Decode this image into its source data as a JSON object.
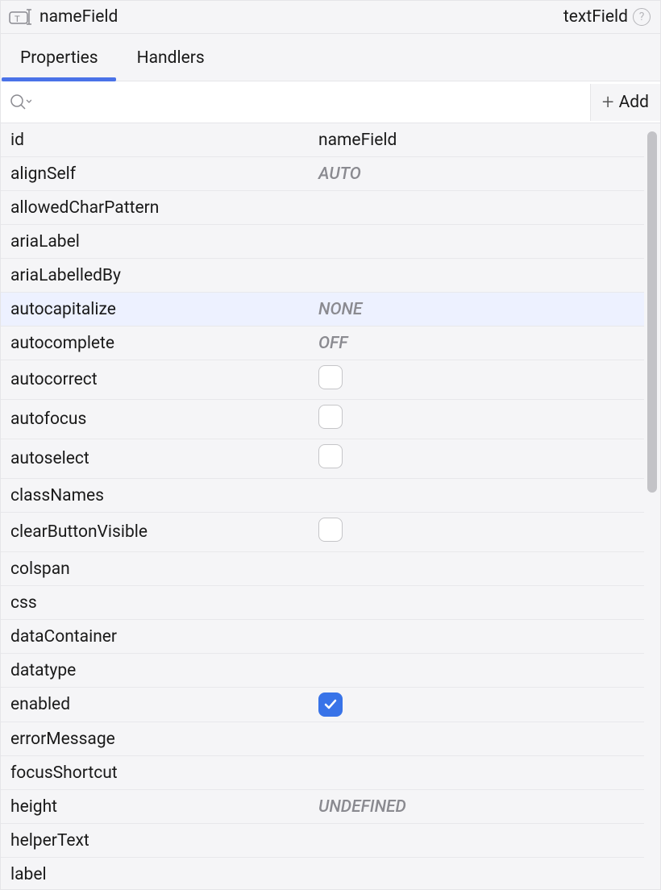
{
  "header": {
    "componentName": "nameField",
    "componentType": "textField"
  },
  "tabs": [
    {
      "label": "Properties",
      "active": true
    },
    {
      "label": "Handlers",
      "active": false
    }
  ],
  "toolbar": {
    "addLabel": "Add",
    "searchPlaceholder": ""
  },
  "properties": [
    {
      "name": "id",
      "value": "nameField",
      "type": "text"
    },
    {
      "name": "alignSelf",
      "value": "AUTO",
      "type": "placeholder"
    },
    {
      "name": "allowedCharPattern",
      "value": "",
      "type": "text"
    },
    {
      "name": "ariaLabel",
      "value": "",
      "type": "text"
    },
    {
      "name": "ariaLabelledBy",
      "value": "",
      "type": "text"
    },
    {
      "name": "autocapitalize",
      "value": "NONE",
      "type": "placeholder",
      "highlighted": true
    },
    {
      "name": "autocomplete",
      "value": "OFF",
      "type": "placeholder"
    },
    {
      "name": "autocorrect",
      "value": "",
      "type": "checkbox",
      "checked": false
    },
    {
      "name": "autofocus",
      "value": "",
      "type": "checkbox",
      "checked": false
    },
    {
      "name": "autoselect",
      "value": "",
      "type": "checkbox",
      "checked": false
    },
    {
      "name": "classNames",
      "value": "",
      "type": "text"
    },
    {
      "name": "clearButtonVisible",
      "value": "",
      "type": "checkbox",
      "checked": false
    },
    {
      "name": "colspan",
      "value": "",
      "type": "text"
    },
    {
      "name": "css",
      "value": "",
      "type": "text"
    },
    {
      "name": "dataContainer",
      "value": "",
      "type": "text"
    },
    {
      "name": "datatype",
      "value": "",
      "type": "text"
    },
    {
      "name": "enabled",
      "value": "",
      "type": "checkbox",
      "checked": true
    },
    {
      "name": "errorMessage",
      "value": "",
      "type": "text"
    },
    {
      "name": "focusShortcut",
      "value": "",
      "type": "text"
    },
    {
      "name": "height",
      "value": "UNDEFINED",
      "type": "placeholder"
    },
    {
      "name": "helperText",
      "value": "",
      "type": "text"
    },
    {
      "name": "label",
      "value": "",
      "type": "text"
    }
  ]
}
